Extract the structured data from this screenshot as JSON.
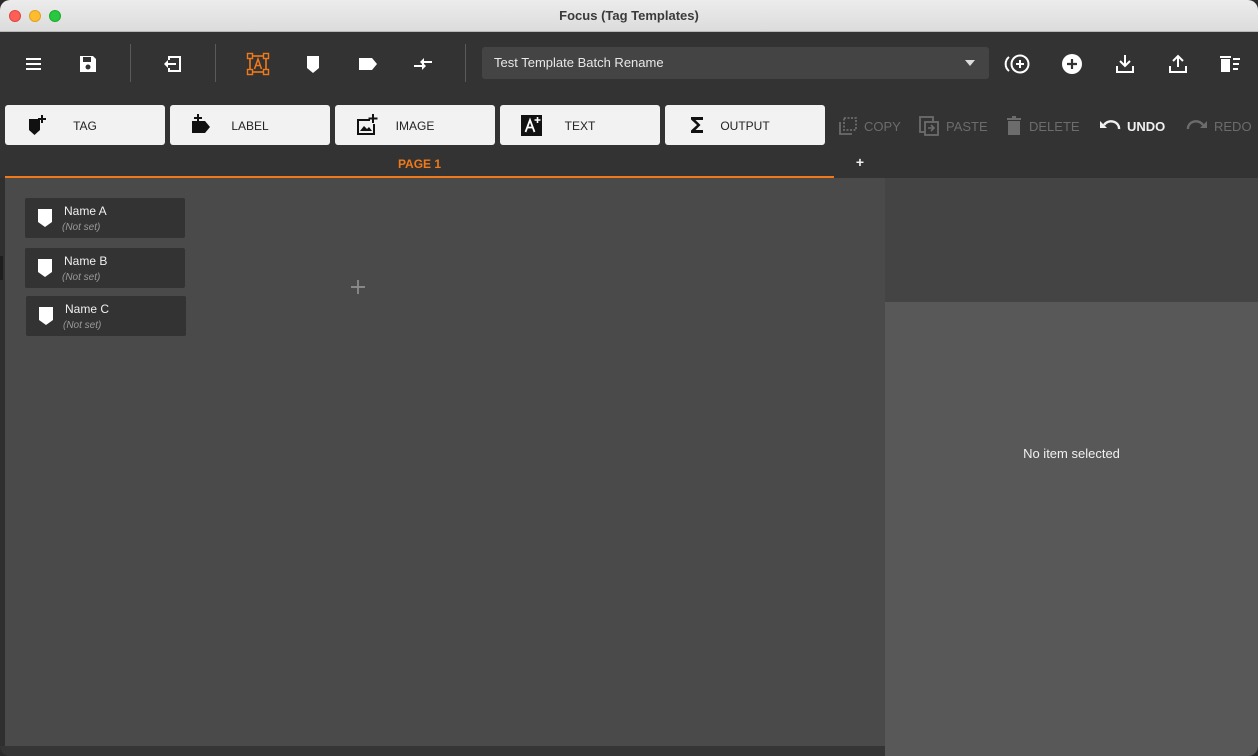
{
  "window": {
    "title": "Focus (Tag Templates)"
  },
  "toolbar": {
    "template_select": {
      "value": "Test Template Batch Rename"
    },
    "icons": [
      "menu-icon",
      "save-icon",
      "exit-icon",
      "select-area-icon",
      "tag-icon",
      "label-icon",
      "compare-icon",
      "add-circle-outline-icon",
      "add-circle-icon",
      "download-icon",
      "upload-icon",
      "delete-list-icon"
    ],
    "accent_color": "#f07a1a"
  },
  "elements": {
    "tag": "TAG",
    "label": "LABEL",
    "image": "IMAGE",
    "text": "TEXT",
    "output": "OUTPUT"
  },
  "actions": {
    "copy": "COPY",
    "paste": "PASTE",
    "delete": "DELETE",
    "undo": "UNDO",
    "redo": "REDO"
  },
  "tabs": {
    "page1": "PAGE 1",
    "add": "+"
  },
  "canvas": {
    "items": [
      {
        "name": "Name A",
        "value": "(Not set)"
      },
      {
        "name": "Name B",
        "value": "(Not set)"
      },
      {
        "name": "Name C",
        "value": "(Not set)"
      }
    ]
  },
  "properties": {
    "empty_message": "No item selected"
  }
}
